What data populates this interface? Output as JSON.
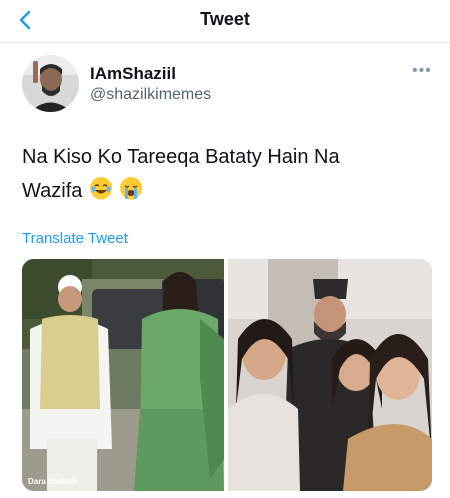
{
  "header": {
    "title": "Tweet",
    "back_icon": "chevron-left-icon"
  },
  "author": {
    "display_name": "IAmShaziil",
    "handle": "@shazilkimemes"
  },
  "tweet": {
    "line1": "Na Kiso Ko Tareeqa Bataty Hain Na",
    "line2": "Wazifa",
    "emojis": [
      "face-with-tears-of-joy-icon",
      "loudly-crying-face-icon"
    ]
  },
  "translate_label": "Translate Tweet",
  "media": {
    "left_caption": "Dara Shekoh"
  },
  "colors": {
    "accent": "#1d9bf0",
    "secondary_text": "#536471",
    "divider": "#e1e8ed"
  }
}
